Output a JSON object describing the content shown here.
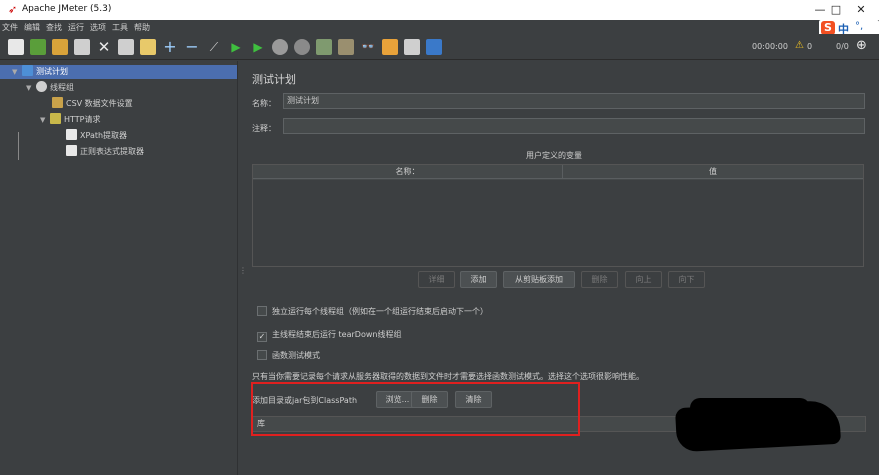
{
  "window": {
    "title": "Apache JMeter (5.3)",
    "minimize": "—",
    "maximize": "□",
    "close": "✕"
  },
  "menu": [
    "文件",
    "编辑",
    "查找",
    "运行",
    "选项",
    "工具",
    "帮助"
  ],
  "ime": {
    "logo": "S",
    "lang": "中",
    "punct": "°,"
  },
  "toolbar": {
    "timer": "00:00:00",
    "warnings": "0",
    "threads": "0/0"
  },
  "tree": {
    "items": [
      {
        "label": "测试计划"
      },
      {
        "label": "线程组"
      },
      {
        "label": "CSV 数据文件设置"
      },
      {
        "label": "HTTP请求"
      },
      {
        "label": "XPath提取器"
      },
      {
        "label": "正则表达式提取器"
      }
    ]
  },
  "panel": {
    "title": "测试计划",
    "name_label": "名称：",
    "name_value": "测试计划",
    "comment_label": "注释：",
    "comment_value": "",
    "udv_title": "用户定义的变量",
    "col_name": "名称：",
    "col_value": "值",
    "buttons": {
      "detail": "详细",
      "add": "添加",
      "add_clipboard": "从剪贴板添加",
      "delete": "删除",
      "up": "向上",
      "down": "向下"
    },
    "checks": {
      "serial": "独立运行每个线程组（例如在一个组运行结束后启动下一个）",
      "teardown": "主线程结束后运行 tearDown线程组",
      "functional": "函数测试模式"
    },
    "note": "只有当你需要记录每个请求从服务器取得的数据到文件时才需要选择函数测试模式。选择这个选项很影响性能。",
    "classpath_label": "添加目录或jar包到ClassPath",
    "browse": "浏览...",
    "cp_delete": "删除",
    "cp_clear": "清除",
    "lib_header": "库"
  },
  "colors": {
    "background": "#3c3f41",
    "selection": "#4b6eaf",
    "highlight_box": "#e0201f"
  }
}
